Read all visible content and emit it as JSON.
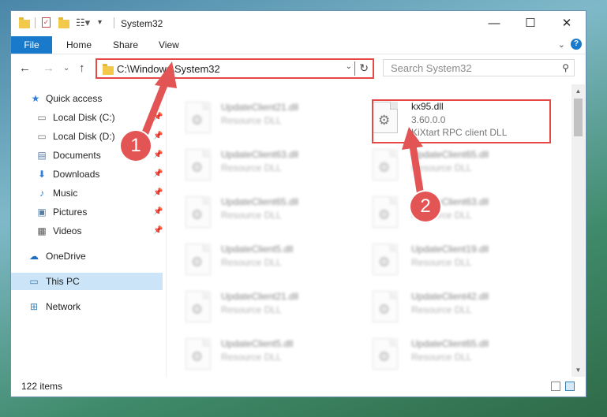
{
  "window": {
    "title": "System32",
    "controls": {
      "minimize": "—",
      "maximize": "☐",
      "close": "✕"
    }
  },
  "ribbon": {
    "tabs": [
      "File",
      "Home",
      "Share",
      "View"
    ],
    "help": "?"
  },
  "nav": {
    "address": "C:\\Windows\\System32",
    "search_placeholder": "Search System32"
  },
  "sidebar": {
    "items": [
      {
        "label": "Quick access",
        "icon": "star-icon",
        "pinned": false
      },
      {
        "label": "Local Disk (C:)",
        "icon": "drive-icon",
        "pinned": true
      },
      {
        "label": "Local Disk (D:)",
        "icon": "drive-icon",
        "pinned": true
      },
      {
        "label": "Documents",
        "icon": "documents-icon",
        "pinned": true
      },
      {
        "label": "Downloads",
        "icon": "downloads-icon",
        "pinned": true
      },
      {
        "label": "Music",
        "icon": "music-icon",
        "pinned": true
      },
      {
        "label": "Pictures",
        "icon": "pictures-icon",
        "pinned": true
      },
      {
        "label": "Videos",
        "icon": "videos-icon",
        "pinned": true
      },
      {
        "label": "OneDrive",
        "icon": "onedrive-icon",
        "pinned": false
      },
      {
        "label": "This PC",
        "icon": "pc-icon",
        "pinned": false,
        "selected": true
      },
      {
        "label": "Network",
        "icon": "network-icon",
        "pinned": false
      }
    ]
  },
  "files": {
    "highlighted": {
      "name": "kx95.dll",
      "version": "3.60.0.0",
      "description": "KiXtart RPC client DLL"
    },
    "left_column": [
      {
        "name": "UpdateClient21.dll",
        "type": "Resource DLL"
      },
      {
        "name": "UpdateClient63.dll",
        "type": "Resource DLL"
      },
      {
        "name": "UpdateClient65.dll",
        "type": "Resource DLL"
      },
      {
        "name": "UpdateClient5.dll",
        "type": "Resource DLL"
      },
      {
        "name": "UpdateClient21.dll",
        "type": "Resource DLL"
      },
      {
        "name": "UpdateClient5.dll",
        "type": "Resource DLL"
      }
    ],
    "right_column": [
      {
        "name": "UpdateClient65.dll",
        "type": "Resource DLL"
      },
      {
        "name": "UpdateClient63.dll",
        "type": "Resource DLL"
      },
      {
        "name": "UpdateClient19.dll",
        "type": "Resource DLL"
      },
      {
        "name": "UpdateClient42.dll",
        "type": "Resource DLL"
      },
      {
        "name": "UpdateClient65.dll",
        "type": "Resource DLL"
      }
    ]
  },
  "status": {
    "item_count": "122 items"
  },
  "callouts": {
    "step1": "1",
    "step2": "2",
    "color": "#e35454"
  }
}
